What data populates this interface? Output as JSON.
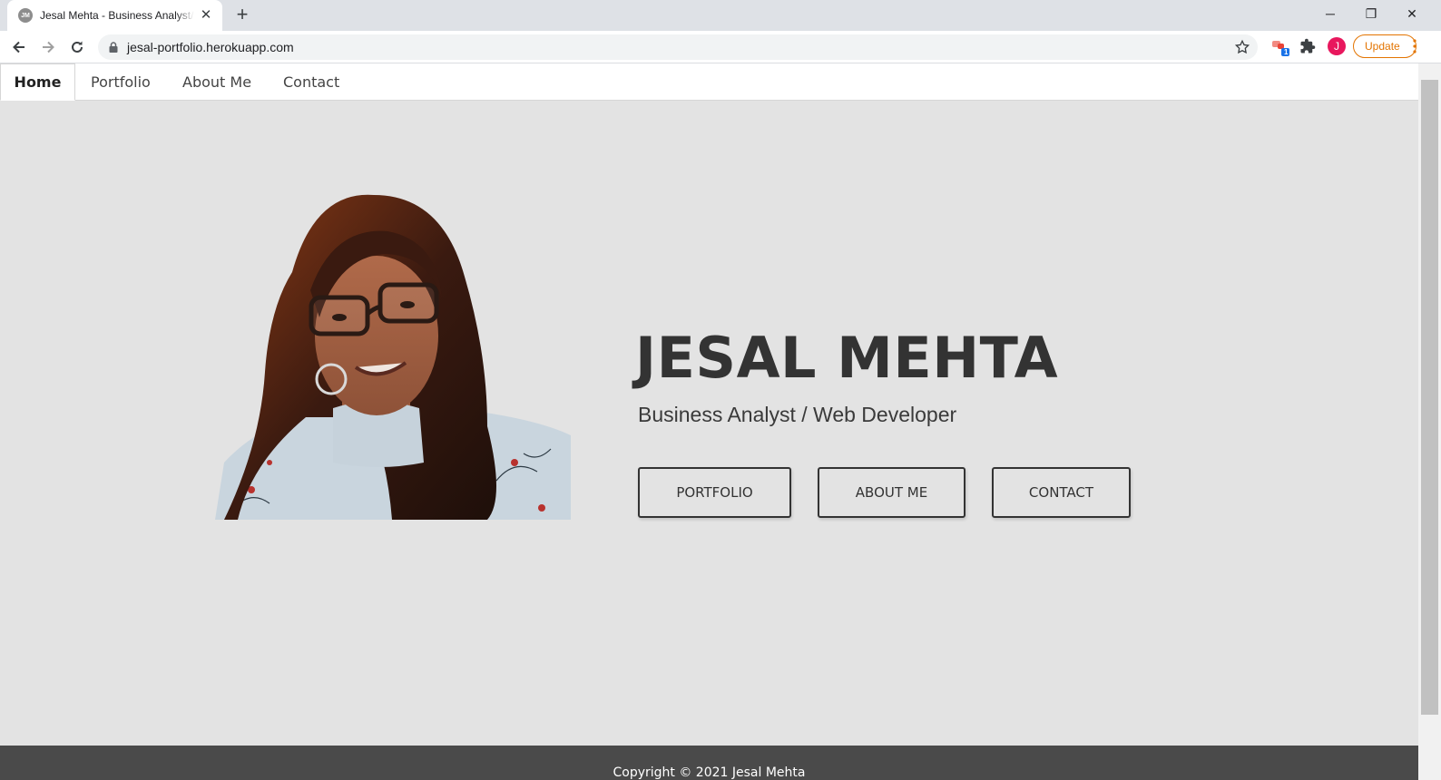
{
  "browser": {
    "tab": {
      "favicon_text": "JM",
      "title": "Jesal Mehta - Business Analyst/Web Developer",
      "close": "✕"
    },
    "new_tab": "+",
    "window_controls": {
      "minimize": "─",
      "restore": "❐",
      "close": "✕"
    },
    "url": "jesal-portfolio.herokuapp.com",
    "extension_badge": "1",
    "profile_initial": "J",
    "update_label": "Update",
    "accent_update": "#e37400",
    "profile_color": "#e8175d"
  },
  "nav": {
    "items": [
      {
        "label": "Home",
        "active": true
      },
      {
        "label": "Portfolio"
      },
      {
        "label": "About Me"
      },
      {
        "label": "Contact"
      }
    ]
  },
  "hero": {
    "photo": "portrait-photo",
    "name": "JESAL MEHTA",
    "subtitle": "Business Analyst / Web Developer",
    "buttons": [
      {
        "label": "PORTFOLIO"
      },
      {
        "label": "ABOUT ME"
      },
      {
        "label": "CONTACT"
      }
    ]
  },
  "footer": {
    "text": "Copyright © 2021 Jesal Mehta"
  }
}
